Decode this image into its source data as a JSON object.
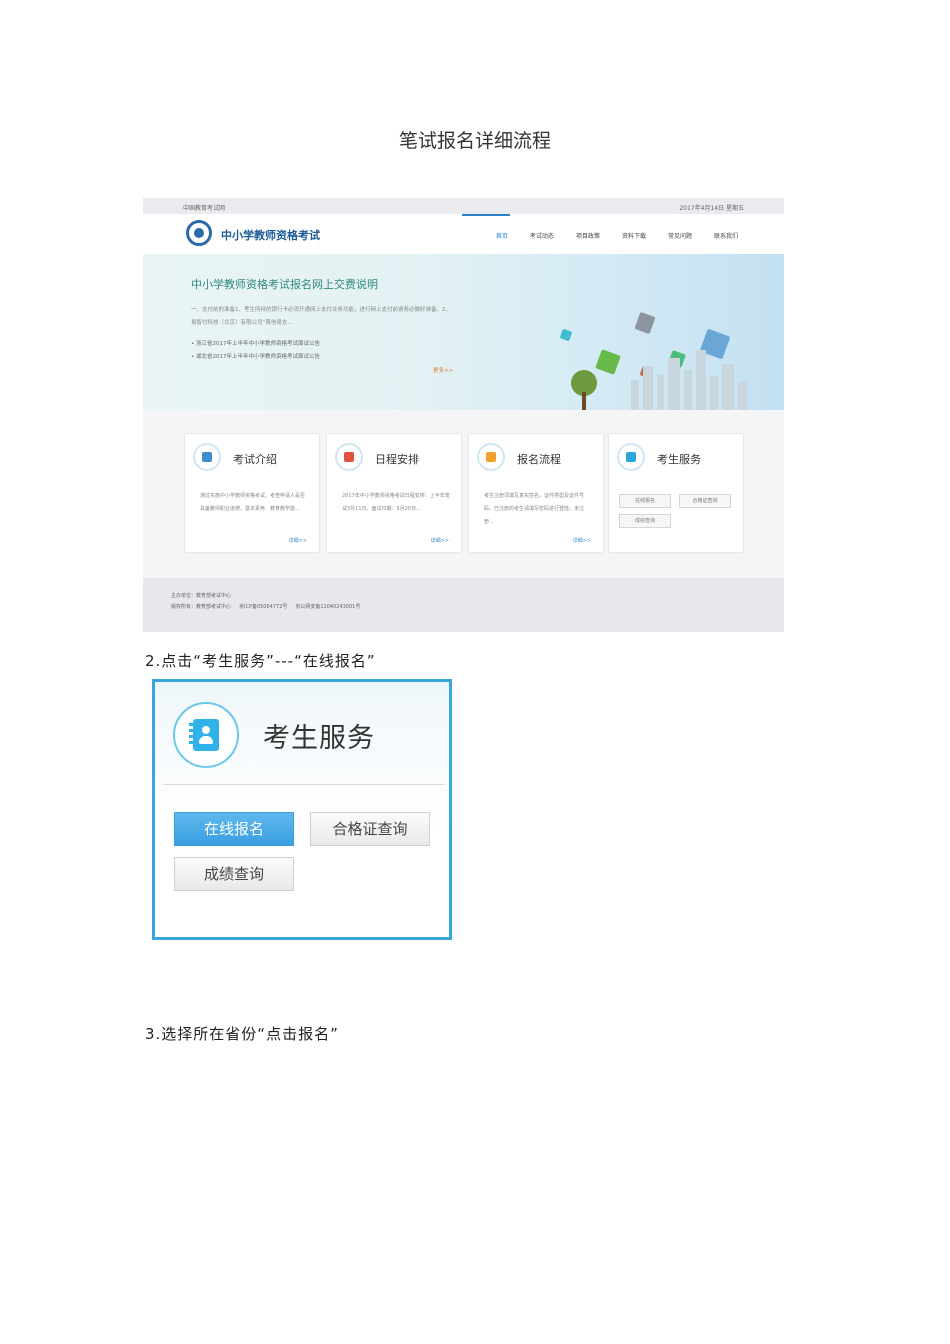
{
  "document": {
    "title": "笔试报名详细流程",
    "step2": "2.点击“考生服务”---“在线报名”",
    "step3": "3.选择所在省份“点击报名”"
  },
  "site": {
    "topbar_left": "中国教育考试网",
    "topbar_right": "2017年4月14日 星期五",
    "logo_text": "中小学教师资格考试",
    "nav": [
      "首页",
      "考试动态",
      "项目政策",
      "资料下载",
      "常见问题",
      "联系我们"
    ],
    "nav_active_index": 0,
    "banner": {
      "title": "中小学教师资格考试报名网上交费说明",
      "text": "一、支付前的准备1、考生所持的银行卡必须开通网上支付业务功能，进行网上支付前请务必做好准备。2、易智付科技（北京）有限公司“首信易支...",
      "list": [
        "浙江省2017年上半年中小学教师资格考试面试公告",
        "湖北省2017年上半年中小学教师资格考试面试公告"
      ],
      "more": "更多>>"
    },
    "cards": [
      {
        "title": "考试介绍",
        "icon": "exam-intro-icon",
        "body": "通过实施中小学教师资格考试，考查申请人是否具备教师职业道德、基本素养、教育教学能...",
        "more": "详细>>"
      },
      {
        "title": "日程安排",
        "icon": "schedule-check-icon",
        "body": "2017年中小学教师资格考试日程安排：上半年笔试3月11日，面试日期：5月20日...",
        "more": "详细>>"
      },
      {
        "title": "报名流程",
        "icon": "registration-process-icon",
        "body": "考生注册须填写真实姓名，证件类型及证件号码。已注册的考生请填写密码进行登陆，未注册...",
        "more": "详细>>"
      },
      {
        "title": "考生服务",
        "icon": "candidate-service-icon",
        "buttons": [
          "在线报名",
          "合格证查询",
          "成绩查询"
        ]
      }
    ],
    "footer": {
      "line1": "主办单位：教育部考试中心",
      "line2a": "版权所有：教育部考试中心",
      "line2b": "京ICP备05064772号",
      "line2c": "京公网安备11040243001号"
    }
  },
  "zoom": {
    "title": "考生服务",
    "icon": "contact-book-icon",
    "buttons": {
      "online_registration": "在线报名",
      "certificate_query": "合格证查询",
      "score_query": "成绩查询"
    }
  },
  "colors": {
    "accent_blue": "#3a9ee0",
    "border_cyan": "#3aa6e0",
    "logo_blue": "#1d5a97",
    "banner_title_green": "#2f8a78"
  }
}
